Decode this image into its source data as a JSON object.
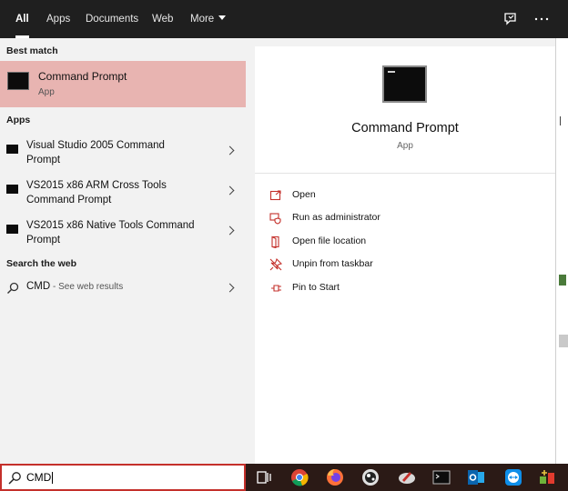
{
  "tabs": [
    {
      "label": "All",
      "active": true
    },
    {
      "label": "Apps"
    },
    {
      "label": "Documents"
    },
    {
      "label": "Web"
    },
    {
      "label": "More"
    }
  ],
  "top_icons": [
    "feedback-icon",
    "more-options-icon"
  ],
  "left": {
    "best_match_heading": "Best match",
    "best_match": {
      "title": "Command Prompt",
      "subtitle": "App",
      "icon": "command-prompt-icon"
    },
    "apps_heading": "Apps",
    "apps": [
      {
        "line1": "Visual Studio 2005 Command",
        "line2": "Prompt"
      },
      {
        "line1": "VS2015 x86 ARM Cross Tools",
        "line2": "Command Prompt"
      },
      {
        "line1": "VS2015 x86 Native Tools Command",
        "line2": "Prompt"
      }
    ],
    "web_heading": "Search the web",
    "web_result": {
      "query": "CMD",
      "suffix": " - See web results"
    }
  },
  "preview": {
    "title": "Command Prompt",
    "subtitle": "App",
    "actions": [
      {
        "label": "Open",
        "icon": "open-icon"
      },
      {
        "label": "Run as administrator",
        "icon": "shield-icon"
      },
      {
        "label": "Open file location",
        "icon": "folder-icon"
      },
      {
        "label": "Unpin from taskbar",
        "icon": "unpin-icon"
      },
      {
        "label": "Pin to Start",
        "icon": "pin-icon"
      }
    ]
  },
  "search": {
    "value": "CMD"
  },
  "taskbar_icons": [
    "task-view-icon",
    "chrome-icon",
    "firefox-icon",
    "app-icon",
    "paint-icon",
    "command-prompt-icon",
    "outlook-icon",
    "teamviewer-icon",
    "app-tool-icon"
  ],
  "colors": {
    "accent": "#c4302b",
    "selected_row": "#e8b4b1",
    "topbar": "#1f1f1f",
    "taskbar": "#2b1a16"
  }
}
